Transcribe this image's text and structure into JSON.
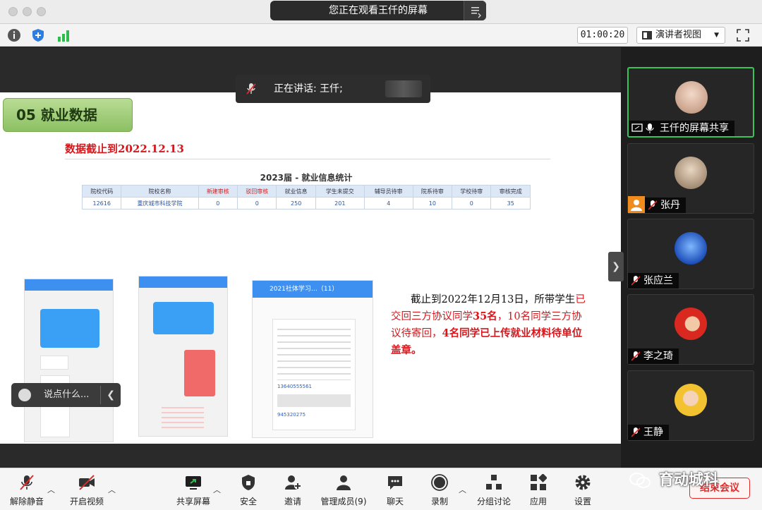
{
  "window": {
    "viewing_title": "您正在观看王仟的屏幕"
  },
  "topbar": {
    "timer": "01:00:20",
    "view_label": "演讲者视图"
  },
  "speaking": {
    "label": "正在讲话: 王仟;"
  },
  "slide": {
    "section_title": "05 就业数据",
    "cutoff_prefix": "数据截止到",
    "cutoff_date": "2022.12.13",
    "stats_title": "2023届 - 就业信息统计",
    "table": {
      "headers": [
        "院校代码",
        "院校名称",
        "新建审核",
        "驳回审核",
        "就业信息",
        "学生未提交",
        "辅导员待审",
        "院系待审",
        "学校待审",
        "审核完成"
      ],
      "red_header_indices": [
        2,
        3
      ],
      "row": [
        "12616",
        "重庆城市科技学院",
        "0",
        "0",
        "250",
        "201",
        "4",
        "10",
        "0",
        "35"
      ]
    },
    "paragraph": {
      "p1": "截止到2022年12月13日，所带学生",
      "p2": "已交回三方协议同学",
      "p3": "35名",
      "p4": "，10名同学三方协议待寄回，",
      "p5": "4名同学已上传就业材料待单位盖章。"
    },
    "phone3": {
      "title": "2021社体学习…（11）",
      "phone_number": "13640555561",
      "id_number": "945320275"
    }
  },
  "chat_input": {
    "placeholder": "说点什么..."
  },
  "participants": [
    {
      "name": "王仟的屏幕共享",
      "active": true
    },
    {
      "name": "张丹",
      "active": false
    },
    {
      "name": "张应兰",
      "active": false
    },
    {
      "name": "李之琦",
      "active": false
    },
    {
      "name": "王静",
      "active": false
    }
  ],
  "toolbar": {
    "mute": "解除静音",
    "video": "开启视频",
    "share": "共享屏幕",
    "security": "安全",
    "invite": "邀请",
    "manage": "管理成员(9)",
    "chat": "聊天",
    "record": "录制",
    "breakout": "分组讨论",
    "apps": "应用",
    "settings": "设置",
    "end": "结束会议"
  },
  "watermark": "育动城科",
  "colors": {
    "accent_red": "#d6171c",
    "active_green": "#39c45a",
    "section_green": "#8cc063"
  }
}
